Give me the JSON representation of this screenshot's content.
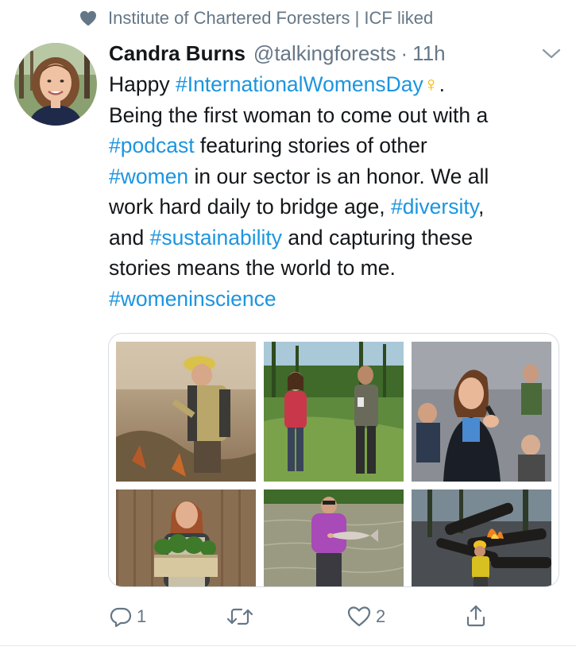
{
  "social_context": {
    "text": "Institute of Chartered Foresters | ICF liked",
    "icon": "heart-icon"
  },
  "author": {
    "name": "Candra Burns",
    "handle": "@talkingforests",
    "separator": "·",
    "time": "11h"
  },
  "tweet": {
    "l1a": "Happy ",
    "l1b": "#InternationalWomensDay",
    "l1c": "♀",
    "l1d": ".",
    "l2": "Being the first woman to come out with a",
    "l3a": "#podcast",
    "l3b": " featuring stories of other",
    "l4a": "#women",
    "l4b": " in our sector is an honor. We all",
    "l5a": "work hard daily to bridge age, ",
    "l5b": "#diversity",
    "l5c": ",",
    "l6a": "and ",
    "l6b": "#sustainability",
    "l6c": " and capturing these",
    "l7": "stories means the world to me.",
    "l8": "#womeninscience"
  },
  "media": {
    "photos": [
      "firefighter-photo",
      "field-conversation-photo",
      "woman-speaking-microphone-photo",
      "woman-holding-seedlings-photo",
      "woman-holding-fish-photo",
      "firefighter-burning-logs-photo"
    ]
  },
  "actions": {
    "reply_count": "1",
    "retweet_count": "",
    "like_count": "2"
  },
  "colors": {
    "hashtag": "#1b95e0",
    "secondary_text": "#657786",
    "venus_symbol": "#f0b400"
  }
}
